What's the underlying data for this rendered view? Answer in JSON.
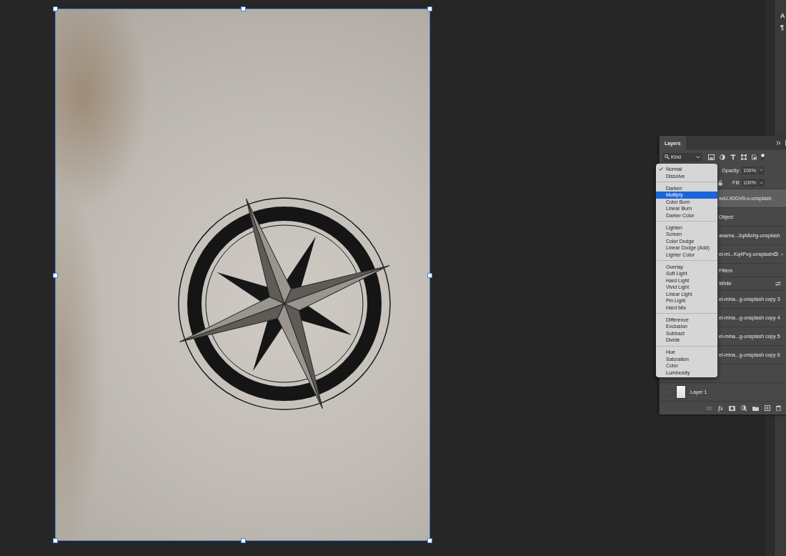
{
  "layers_panel": {
    "title": "Layers",
    "filter": {
      "value": "Kind"
    },
    "opacity": {
      "label": "Opacity:",
      "value": "100%"
    },
    "fill": {
      "label": "Fill:",
      "value": "100%"
    },
    "layers": [
      {
        "kind": "layer",
        "name": "xvU-X0GV9-o-unsplash",
        "selected": true
      },
      {
        "kind": "layer",
        "name": "Object",
        "selected": false
      },
      {
        "kind": "layer",
        "name": "anama...3qA8ohg-unsplash",
        "selected": false
      },
      {
        "kind": "smart",
        "name": "el-mi...Kq4Pvg-unsplash",
        "selected": false,
        "expanded": true
      },
      {
        "kind": "filters",
        "name": "Filters",
        "selected": false
      },
      {
        "kind": "filter",
        "name": "White",
        "selected": false
      },
      {
        "kind": "layer",
        "name": "el-mina...g-unsplash copy 3",
        "selected": false
      },
      {
        "kind": "layer",
        "name": "el-mina...g-unsplash copy 4",
        "selected": false
      },
      {
        "kind": "layer",
        "name": "el-mina...g-unsplash copy 5",
        "selected": false
      },
      {
        "kind": "layer",
        "name": "el-mina...g-unsplash copy 6",
        "selected": false
      },
      {
        "kind": "layer",
        "selected": false
      },
      {
        "kind": "layer",
        "name": "Layer 1",
        "selected": false,
        "visible": false
      }
    ],
    "footer": {
      "effects_label": "fx"
    }
  },
  "blend_menu": {
    "groups": [
      [
        {
          "label": "Normal",
          "checked": true,
          "selected": false
        },
        {
          "label": "Dissolve",
          "checked": false,
          "selected": false
        }
      ],
      [
        {
          "label": "Darken",
          "checked": false,
          "selected": false
        },
        {
          "label": "Multiply",
          "checked": false,
          "selected": true
        },
        {
          "label": "Color Burn",
          "checked": false,
          "selected": false
        },
        {
          "label": "Linear Burn",
          "checked": false,
          "selected": false
        },
        {
          "label": "Darker Color",
          "checked": false,
          "selected": false
        }
      ],
      [
        {
          "label": "Lighten",
          "checked": false,
          "selected": false
        },
        {
          "label": "Screen",
          "checked": false,
          "selected": false
        },
        {
          "label": "Color Dodge",
          "checked": false,
          "selected": false
        },
        {
          "label": "Linear Dodge (Add)",
          "checked": false,
          "selected": false
        },
        {
          "label": "Lighter Color",
          "checked": false,
          "selected": false
        }
      ],
      [
        {
          "label": "Overlay",
          "checked": false,
          "selected": false
        },
        {
          "label": "Soft Light",
          "checked": false,
          "selected": false
        },
        {
          "label": "Hard Light",
          "checked": false,
          "selected": false
        },
        {
          "label": "Vivid Light",
          "checked": false,
          "selected": false
        },
        {
          "label": "Linear Light",
          "checked": false,
          "selected": false
        },
        {
          "label": "Pin Light",
          "checked": false,
          "selected": false
        },
        {
          "label": "Hard Mix",
          "checked": false,
          "selected": false
        }
      ],
      [
        {
          "label": "Difference",
          "checked": false,
          "selected": false
        },
        {
          "label": "Exclusion",
          "checked": false,
          "selected": false
        },
        {
          "label": "Subtract",
          "checked": false,
          "selected": false
        },
        {
          "label": "Divide",
          "checked": false,
          "selected": false
        }
      ],
      [
        {
          "label": "Hue",
          "checked": false,
          "selected": false
        },
        {
          "label": "Saturation",
          "checked": false,
          "selected": false
        },
        {
          "label": "Color",
          "checked": false,
          "selected": false
        },
        {
          "label": "Luminosity",
          "checked": false,
          "selected": false
        }
      ]
    ]
  },
  "dock": {
    "buttons": [
      "A",
      "¶"
    ]
  }
}
